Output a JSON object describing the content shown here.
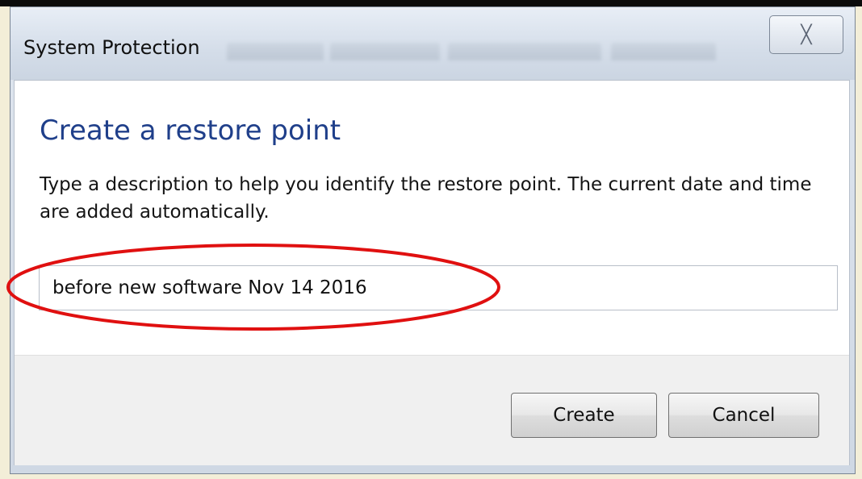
{
  "window": {
    "title": "System Protection",
    "close_glyph": "╳"
  },
  "dialog": {
    "heading": "Create a restore point",
    "description": "Type a description to help you identify the restore point. The current date and time are added automatically.",
    "input": {
      "value": "before new software Nov 14 2016",
      "placeholder": ""
    },
    "buttons": {
      "create_label": "Create",
      "cancel_label": "Cancel"
    }
  },
  "annotation": {
    "highlight_color": "#e01010"
  },
  "icons": {
    "close": "close-icon"
  }
}
